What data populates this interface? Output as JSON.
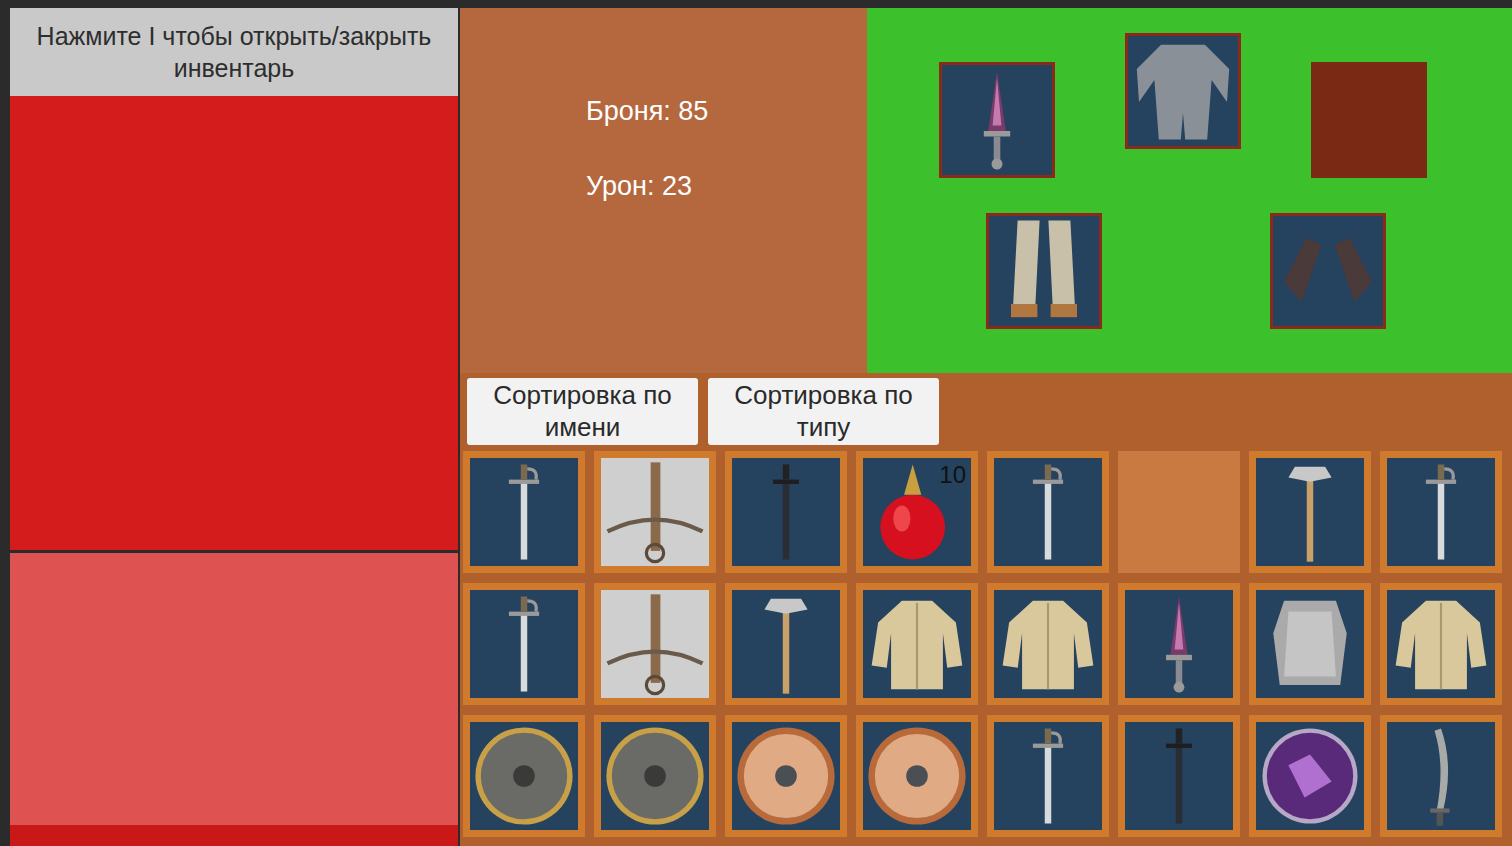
{
  "hint": "Нажмите I чтобы открыть/закрыть инвентарь",
  "stats": [
    {
      "label": "Броня: 85"
    },
    {
      "label": "Урон: 23"
    }
  ],
  "equipment": [
    {
      "kind": "dagger",
      "empty": false
    },
    {
      "kind": "chainmail",
      "empty": false
    },
    {
      "kind": "none",
      "empty": true
    },
    {
      "kind": "greaves",
      "empty": false
    },
    {
      "kind": "gauntlets",
      "empty": false
    }
  ],
  "sort_buttons": [
    "Сортировка по имени",
    "Сортировка по типу"
  ],
  "inventory": [
    {
      "kind": "sword",
      "empty": false
    },
    {
      "kind": "crossbow",
      "empty": false
    },
    {
      "kind": "blackblade",
      "empty": false
    },
    {
      "kind": "potion",
      "empty": false,
      "count": "10"
    },
    {
      "kind": "sword",
      "empty": false
    },
    {
      "kind": "none",
      "empty": true
    },
    {
      "kind": "axe",
      "empty": false
    },
    {
      "kind": "sword",
      "empty": false
    },
    {
      "kind": "sword",
      "empty": false
    },
    {
      "kind": "crossbow",
      "empty": false
    },
    {
      "kind": "axe",
      "empty": false
    },
    {
      "kind": "gambeson",
      "empty": false
    },
    {
      "kind": "gambeson",
      "empty": false
    },
    {
      "kind": "dagger",
      "empty": false
    },
    {
      "kind": "cuirass",
      "empty": false
    },
    {
      "kind": "gambeson",
      "empty": false
    },
    {
      "kind": "roundshield",
      "empty": false
    },
    {
      "kind": "roundshield",
      "empty": false
    },
    {
      "kind": "woodshield",
      "empty": false
    },
    {
      "kind": "woodshield",
      "empty": false
    },
    {
      "kind": "sword",
      "empty": false
    },
    {
      "kind": "blackblade",
      "empty": false
    },
    {
      "kind": "orb",
      "empty": false
    },
    {
      "kind": "sabre",
      "empty": false
    }
  ]
}
